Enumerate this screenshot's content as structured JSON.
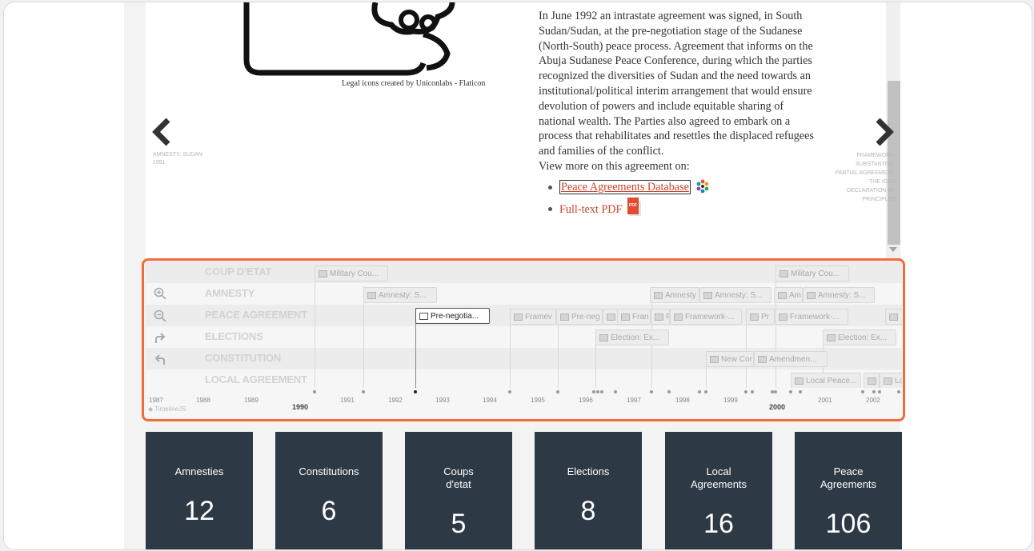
{
  "slide": {
    "credit": "Legal icons created by Uniconlabs - Flaticon",
    "paragraph": "In June 1992 an intrastate agreement was signed, in South Sudan/Sudan, at the pre-negotiation stage of the Sudanese (North-South) peace process. Agreement that informs on the Abuja Sudanese Peace Conference, during which the parties recognized the diversities of Sudan and the need towards an institutional/political interim arrangement that would ensure devolution of powers and include equitable sharing of national wealth. The Parties also agreed to embark on a process that rehabilitates and resettles the displaced refugees and families of the conflict.",
    "view_more": "View more on this agreement on:",
    "links": [
      "Peace Agreements Database",
      "Full-text PDF"
    ],
    "pdf_label": "PDF"
  },
  "nav": {
    "prev_title": "AMNESTY: SUDAN",
    "prev_year": "1991",
    "next_title": "FRAMEWORK-SUBSTANTIVE, PARTIAL AGREEMENT: THE IGAD DECLARATION OF PRINCIPLES"
  },
  "timeline": {
    "rows": [
      "COUP D'ETAT",
      "AMNESTY",
      "PEACE AGREEMENT",
      "ELECTIONS",
      "CONSTITUTION",
      "LOCAL AGREEMENT"
    ],
    "markers": {
      "coup": [
        "Military Cou...",
        "Military Cou..."
      ],
      "amnesty": [
        "Amnesty: S...",
        "Amnesty",
        "Amnesty: S...",
        "Am",
        "Amnesty: S..."
      ],
      "peace": [
        "Pre-negotia...",
        "Framev",
        "Pre-neg",
        "",
        "Fran",
        "F",
        "Framework-...",
        "Pr",
        "Framework-...",
        ""
      ],
      "elections": [
        "Election: Ex...",
        "Election: Ex..."
      ],
      "constitution": [
        "New Cor",
        "Amendmen..."
      ],
      "local": [
        "Local Peace...",
        "",
        "Lo"
      ]
    },
    "years": [
      "1987",
      "1988",
      "1989",
      "1991",
      "1992",
      "1993",
      "1994",
      "1995",
      "1996",
      "1997",
      "1998",
      "1999",
      "2001",
      "2002"
    ],
    "major_years": [
      "1990",
      "2000"
    ],
    "brand": "TimelineJS"
  },
  "cards": [
    {
      "title": "Amnesties",
      "value": "12"
    },
    {
      "title": "Constitutions",
      "value": "6"
    },
    {
      "title": "Coups d'etat",
      "value": "5"
    },
    {
      "title": "Elections",
      "value": "8"
    },
    {
      "title": "Local Agreements",
      "value": "16"
    },
    {
      "title": "Peace Agreements",
      "value": "106"
    }
  ],
  "colors": {
    "accent": "#f36c3a",
    "card_bg": "#2d3945",
    "link": "#c8432b"
  }
}
